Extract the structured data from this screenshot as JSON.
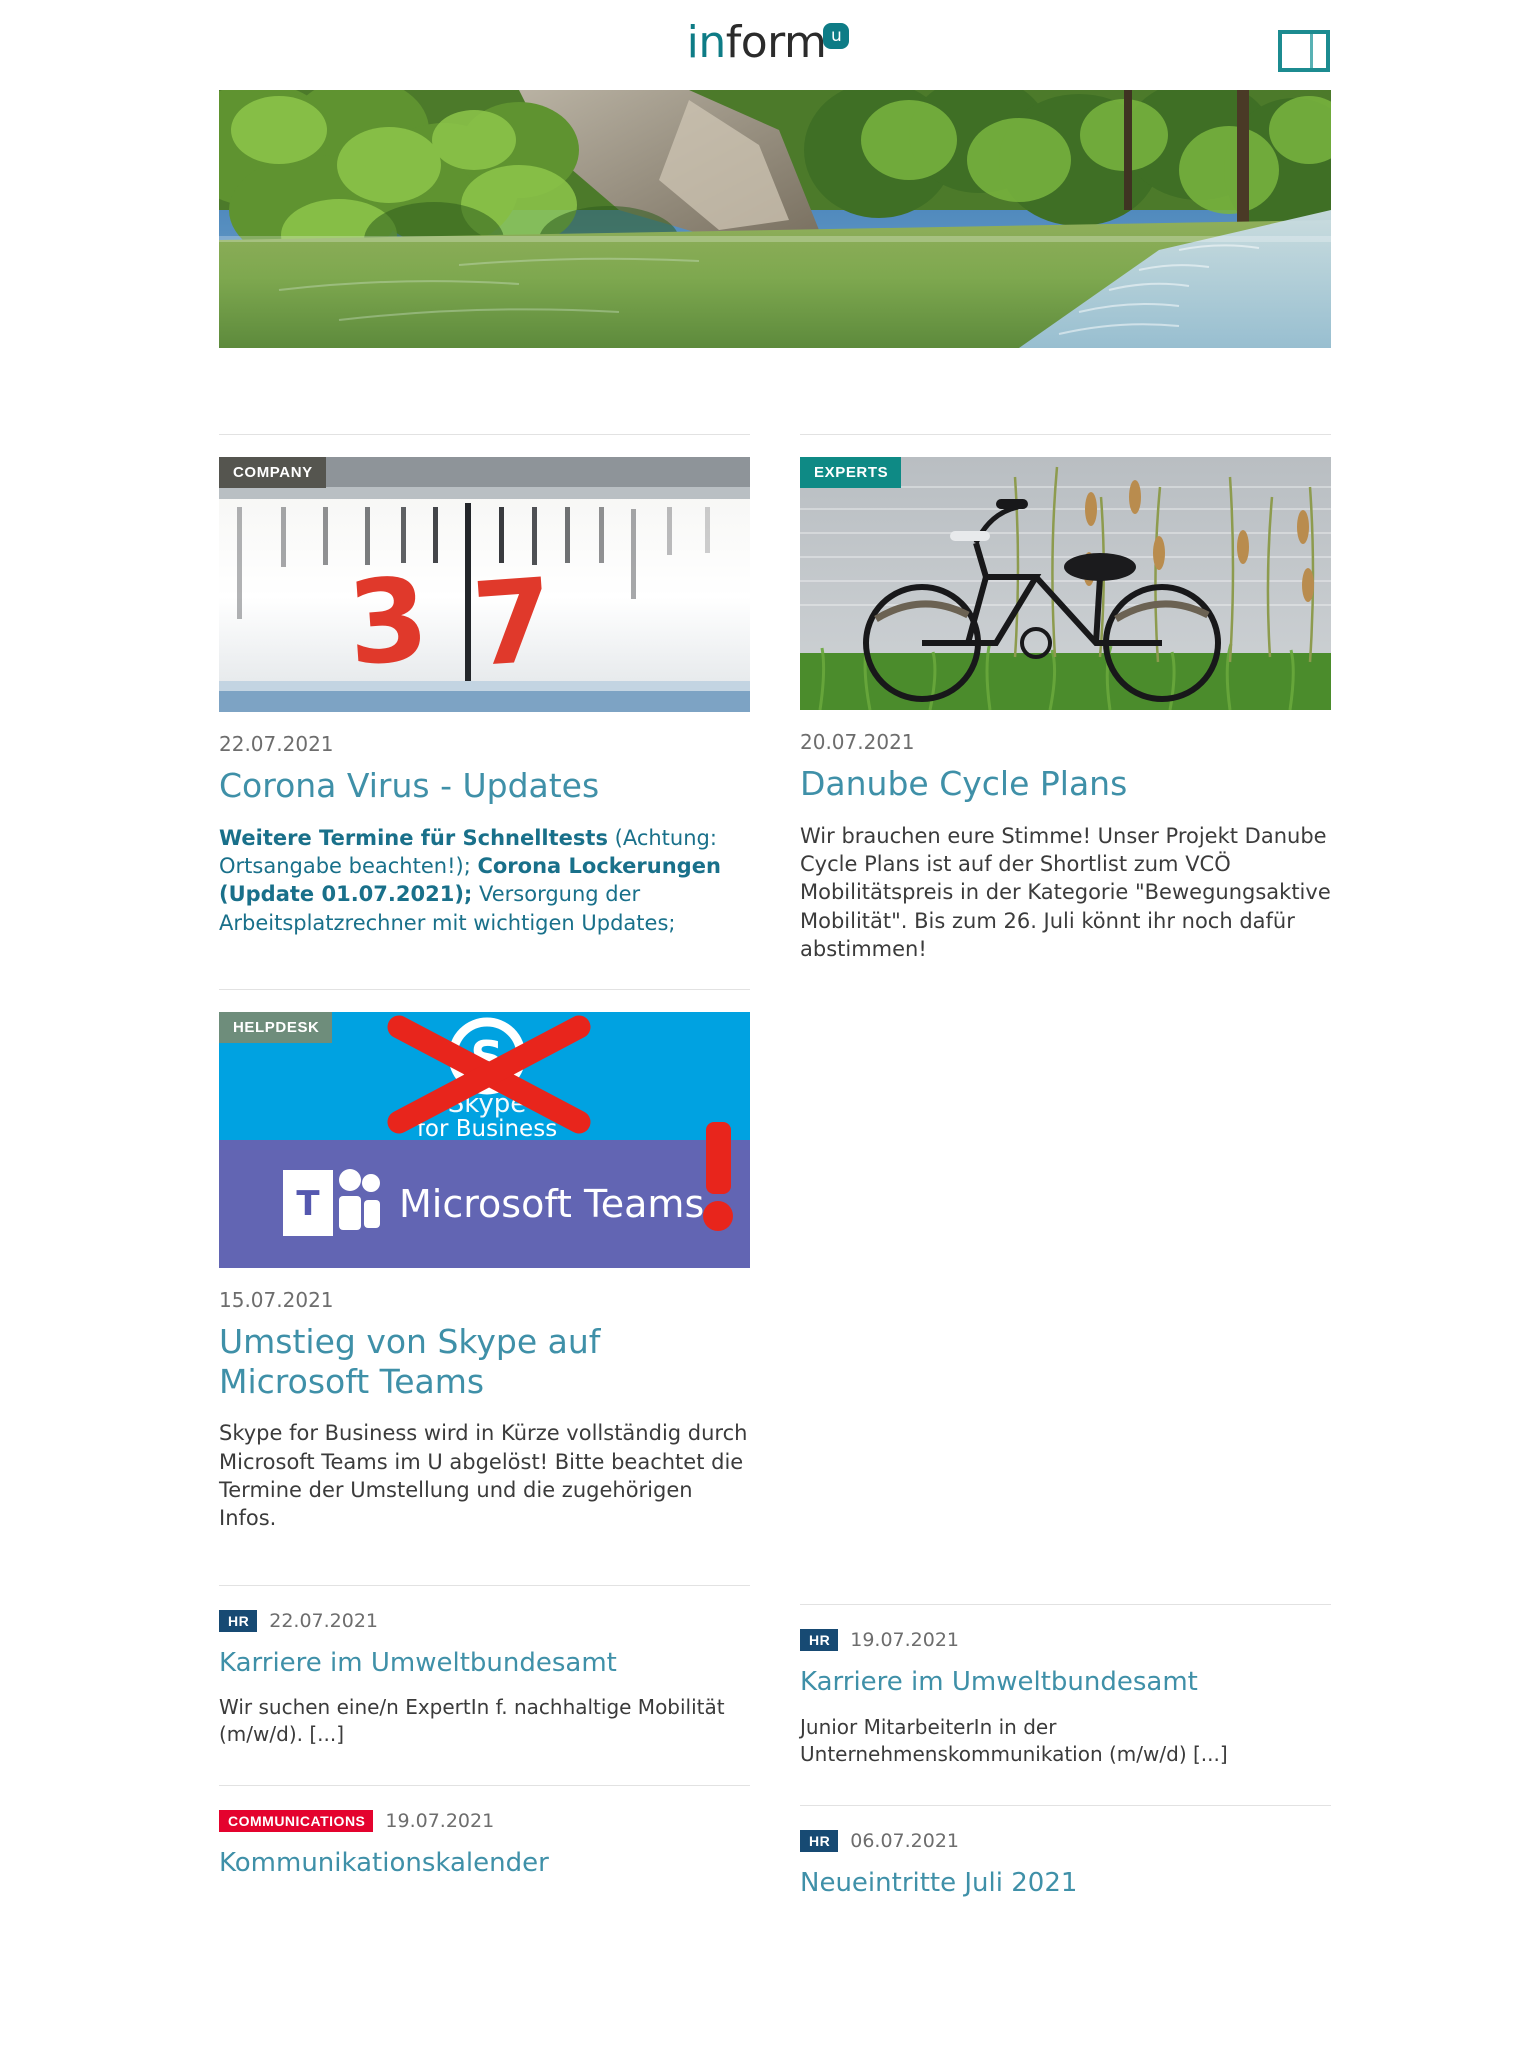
{
  "header": {
    "logo_primary": "in",
    "logo_secondary": "form",
    "logo_badge": "u",
    "panel_toggle_name": "layout-panel-toggle"
  },
  "hero": {
    "alt": "River flowing through a green forest gorge"
  },
  "features": [
    {
      "badge": "COMPANY",
      "badge_color": "#55554f",
      "image_alt": "Close-up of a thermometer scale reading 37",
      "date": "22.07.2021",
      "title": "Corona Virus - Updates",
      "body_segments": [
        {
          "text": "Weitere Termine für Schnelltests",
          "bold": true
        },
        {
          "text": " (Achtung: Ortsangabe beachten!); ",
          "bold": false
        },
        {
          "text": "Corona Lockerungen (Update 01.07.2021);",
          "bold": true
        },
        {
          "text": " Versorgung der Arbeitsplatzrechner mit wichtigen Updates;",
          "bold": false
        }
      ],
      "body_color": "teal"
    },
    {
      "badge": "EXPERTS",
      "badge_color": "#0e8a85",
      "image_alt": "Black bicycle standing in grass beside water",
      "date": "20.07.2021",
      "title": "Danube Cycle Plans",
      "body_segments": [
        {
          "text": "Wir brauchen eure Stimme! Unser Projekt Danube Cycle Plans ist auf der Shortlist zum VCÖ Mobilitätspreis in der Kategorie \"Bewegungsaktive Mobilität\". Bis zum 26. Juli könnt ihr noch dafür abstimmen!",
          "bold": false
        }
      ],
      "body_color": "gray"
    },
    {
      "badge": "HELPDESK",
      "badge_color": "#6e8d7b",
      "image_alt": "Skype for Business logo crossed out in red above the Microsoft Teams logo with a red exclamation mark",
      "date": "15.07.2021",
      "title": "Umstieg von Skype auf Microsoft Teams",
      "body_segments": [
        {
          "text": "Skype for Business wird in Kürze vollständig durch Microsoft Teams im U abgelöst! Bitte beachtet die Termine der Umstellung und die zugehörigen Infos.",
          "bold": false
        }
      ],
      "body_color": "gray"
    }
  ],
  "teams_graphic": {
    "skype_label_line1": "Skype",
    "skype_label_line2": "for Business",
    "teams_label": "Microsoft Teams",
    "teams_letter": "T",
    "skype_letter": "S",
    "exclamation": "!",
    "skype_bg": "#00a2e1",
    "teams_bg": "#6265b3",
    "cross_color": "#e8251c"
  },
  "list_items_left": [
    {
      "tag": "HR",
      "tag_class": "hr",
      "date": "22.07.2021",
      "title": "Karriere im Umweltbundesamt",
      "body": "Wir suchen eine/n ExpertIn f. nachhaltige Mobilität (m/w/d). [...]"
    },
    {
      "tag": "COMMUNICATIONS",
      "tag_class": "comm",
      "date": "19.07.2021",
      "title": "Kommunikationskalender",
      "body": ""
    }
  ],
  "list_items_right": [
    {
      "tag": "HR",
      "tag_class": "hr",
      "date": "19.07.2021",
      "title": "Karriere im Umweltbundesamt",
      "body": "Junior MitarbeiterIn in der Unternehmenskommunikation (m/w/d) [...]"
    },
    {
      "tag": "HR",
      "tag_class": "hr",
      "date": "06.07.2021",
      "title": "Neueintritte Juli 2021",
      "body": ""
    }
  ],
  "colors": {
    "accent_teal": "#0e7c86",
    "link_blue": "#3f90a8",
    "body_teal": "#19708a",
    "body_gray": "#3b3b3b",
    "date_gray": "#6d6d6d",
    "divider": "#e2e2e2",
    "hr_tag": "#174a73",
    "comm_tag": "#e4032e"
  }
}
